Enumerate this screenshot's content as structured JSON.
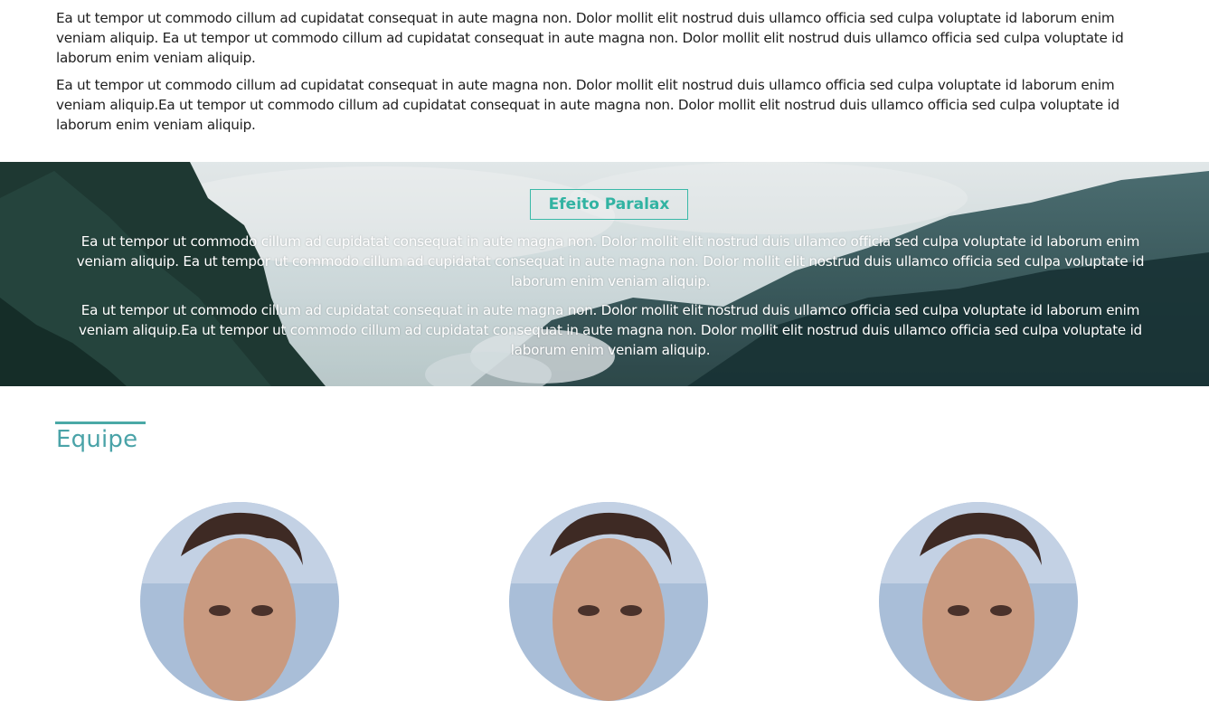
{
  "intro": {
    "paragraphs": [
      "Ea ut tempor ut commodo cillum ad cupidatat consequat in aute magna non. Dolor mollit elit nostrud duis ullamco officia sed culpa voluptate id laborum enim veniam aliquip. Ea ut tempor ut commodo cillum ad cupidatat consequat in aute magna non. Dolor mollit elit nostrud duis ullamco officia sed culpa voluptate id laborum enim veniam aliquip.",
      "Ea ut tempor ut commodo cillum ad cupidatat consequat in aute magna non. Dolor mollit elit nostrud duis ullamco officia sed culpa voluptate id laborum enim veniam aliquip.Ea ut tempor ut commodo cillum ad cupidatat consequat in aute magna non. Dolor mollit elit nostrud duis ullamco officia sed culpa voluptate id laborum enim veniam aliquip."
    ]
  },
  "parallax": {
    "title": "Efeito Paralax",
    "paragraphs": [
      "Ea ut tempor ut commodo cillum ad cupidatat consequat in aute magna non. Dolor mollit elit nostrud duis ullamco officia sed culpa voluptate id laborum enim veniam aliquip. Ea ut tempor ut commodo cillum ad cupidatat consequat in aute magna non. Dolor mollit elit nostrud duis ullamco officia sed culpa voluptate id laborum enim veniam aliquip.",
      "Ea ut tempor ut commodo cillum ad cupidatat consequat in aute magna non. Dolor mollit elit nostrud duis ullamco officia sed culpa voluptate id laborum enim veniam aliquip.Ea ut tempor ut commodo cillum ad cupidatat consequat in aute magna non. Dolor mollit elit nostrud duis ullamco officia sed culpa voluptate id laborum enim veniam aliquip."
    ],
    "accent_color": "#31b3a2"
  },
  "team": {
    "heading": "Equipe",
    "heading_color": "#4aa3a8",
    "members": [
      {
        "photo": "team-member-photo"
      },
      {
        "photo": "team-member-photo"
      },
      {
        "photo": "team-member-photo"
      }
    ]
  }
}
